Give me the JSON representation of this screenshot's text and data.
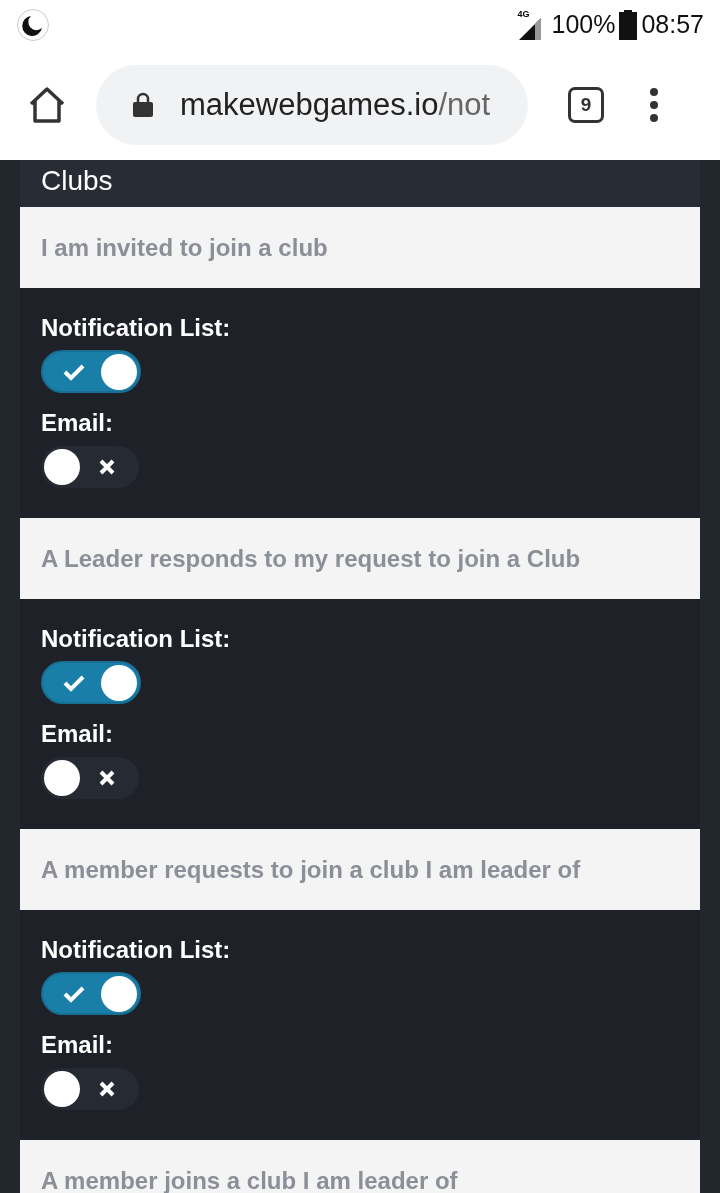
{
  "status_bar": {
    "network": "4G",
    "battery": "100%",
    "time": "08:57"
  },
  "browser": {
    "url_host": "makewebgames.io",
    "url_path": "/not",
    "tab_count": "9"
  },
  "panel": {
    "title": "Clubs",
    "sections": [
      {
        "title": "I am invited to join a club",
        "settings": [
          {
            "label": "Notification List:",
            "on": true
          },
          {
            "label": "Email:",
            "on": false
          }
        ]
      },
      {
        "title": "A Leader responds to my request to join a Club",
        "settings": [
          {
            "label": "Notification List:",
            "on": true
          },
          {
            "label": "Email:",
            "on": false
          }
        ]
      },
      {
        "title": "A member requests to join a club I am leader of",
        "settings": [
          {
            "label": "Notification List:",
            "on": true
          },
          {
            "label": "Email:",
            "on": false
          }
        ]
      },
      {
        "title": "A member joins a club I am leader of"
      }
    ]
  }
}
